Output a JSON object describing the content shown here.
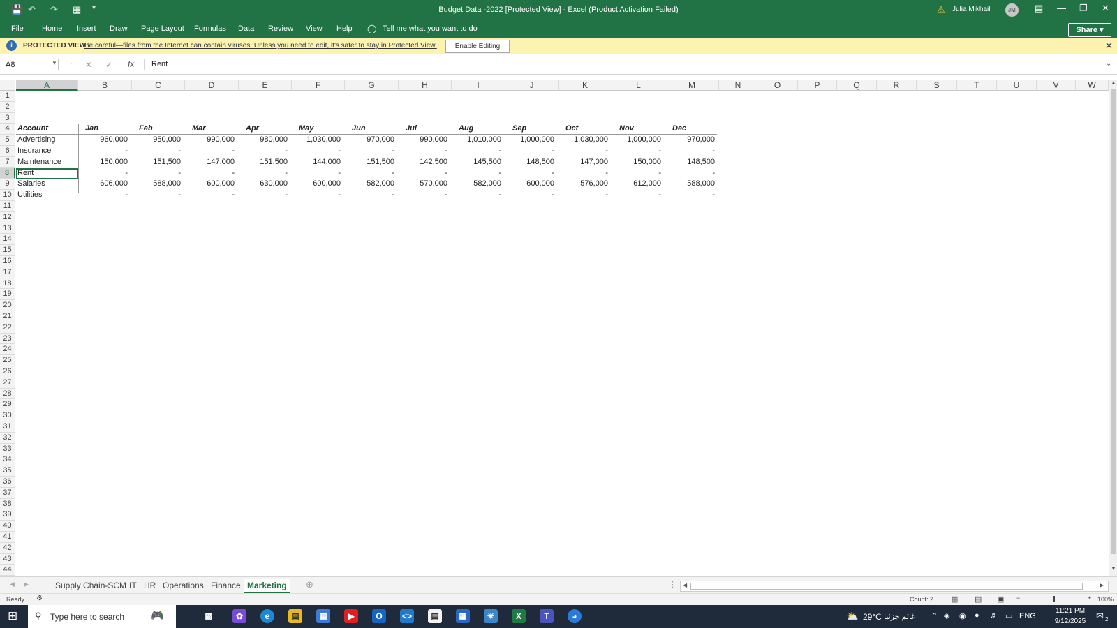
{
  "window": {
    "title": "Budget Data -2022  [Protected View]  -  Excel (Product Activation Failed)",
    "user": "Julia Mikhail",
    "user_initials": "JM"
  },
  "ribbon": {
    "tabs": [
      "File",
      "Home",
      "Insert",
      "Draw",
      "Page Layout",
      "Formulas",
      "Data",
      "Review",
      "View",
      "Help"
    ],
    "tell_me": "Tell me what you want to do",
    "share": "Share"
  },
  "protected_view": {
    "label": "PROTECTED VIEW",
    "message": "Be careful—files from the Internet can contain viruses. Unless you need to edit, it's safer to stay in Protected View.",
    "button": "Enable Editing"
  },
  "formula_bar": {
    "name_box": "A8",
    "fx": "fx",
    "formula": "Rent"
  },
  "grid": {
    "columns": [
      "A",
      "B",
      "C",
      "D",
      "E",
      "F",
      "G",
      "H",
      "I",
      "J",
      "K",
      "L",
      "M",
      "N",
      "O",
      "P",
      "Q",
      "R",
      "S",
      "T",
      "U",
      "V",
      "W"
    ],
    "row_numbers": [
      "1",
      "2",
      "3",
      "4",
      "5",
      "6",
      "7",
      "8",
      "9",
      "10",
      "11",
      "12",
      "13",
      "14",
      "15",
      "16",
      "17",
      "18",
      "19",
      "20",
      "21",
      "22",
      "23",
      "24",
      "25",
      "26",
      "27",
      "28",
      "29",
      "30",
      "31",
      "32",
      "33",
      "34",
      "35",
      "36",
      "37",
      "38",
      "39",
      "40",
      "41",
      "42",
      "43",
      "44"
    ],
    "header_row": [
      "Account",
      "Jan",
      "Feb",
      "Mar",
      "Apr",
      "May",
      "Jun",
      "Jul",
      "Aug",
      "Sep",
      "Oct",
      "Nov",
      "Dec"
    ],
    "data_rows": [
      [
        "Advertising",
        "960,000",
        "950,000",
        "990,000",
        "980,000",
        "1,030,000",
        "970,000",
        "990,000",
        "1,010,000",
        "1,000,000",
        "1,030,000",
        "1,000,000",
        "970,000"
      ],
      [
        "Insurance",
        "-",
        "-",
        "-",
        "-",
        "-",
        "-",
        "-",
        "-",
        "-",
        "-",
        "-",
        "-"
      ],
      [
        "Maintenance",
        "150,000",
        "151,500",
        "147,000",
        "151,500",
        "144,000",
        "151,500",
        "142,500",
        "145,500",
        "148,500",
        "147,000",
        "150,000",
        "148,500"
      ],
      [
        "Rent",
        "-",
        "-",
        "-",
        "-",
        "-",
        "-",
        "-",
        "-",
        "-",
        "-",
        "-",
        "-"
      ],
      [
        "Salaries",
        "606,000",
        "588,000",
        "600,000",
        "630,000",
        "600,000",
        "582,000",
        "570,000",
        "582,000",
        "600,000",
        "576,000",
        "612,000",
        "588,000"
      ],
      [
        "Utilities",
        "-",
        "-",
        "-",
        "-",
        "-",
        "-",
        "-",
        "-",
        "-",
        "-",
        "-",
        "-"
      ]
    ],
    "selected_cell": "A8"
  },
  "sheets": {
    "tabs": [
      "Supply Chain-SCM",
      "IT",
      "HR",
      "Operations",
      "Finance",
      "Marketing"
    ],
    "active": "Marketing"
  },
  "status_bar": {
    "ready": "Ready",
    "count": "Count: 2",
    "zoom": "100%"
  },
  "taskbar": {
    "search_placeholder": "Type here to search",
    "weather": "29°C",
    "weather_text": "غائم جزئيا",
    "lang": "ENG",
    "time": "11:21 PM",
    "date": "9/12/2025",
    "notification_count": "2"
  }
}
